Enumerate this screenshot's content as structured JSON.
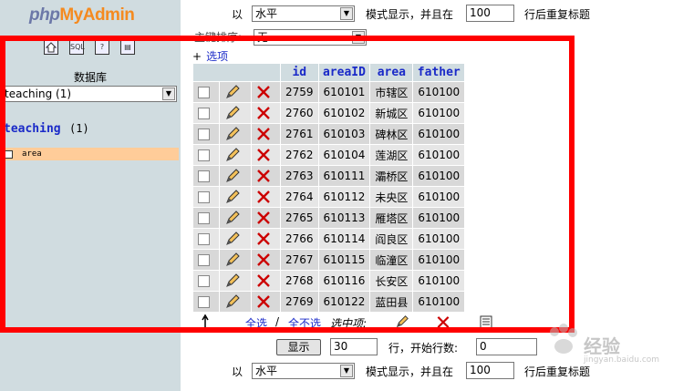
{
  "sidebar": {
    "logo": {
      "php": "php",
      "my": "My",
      "admin": "Admin"
    },
    "toolbar_icons": [
      "home-icon",
      "sql-icon",
      "help-icon",
      "docs-icon"
    ],
    "db_label": "数据库",
    "db_select_value": "teaching (1)",
    "db_link": "teaching",
    "db_count": "(1)",
    "table_item": "area"
  },
  "top_controls": {
    "prefix": "以",
    "mode_value": "水平",
    "mode_suffix": "模式显示，并且在",
    "repeat_value": "100",
    "repeat_suffix": "行后重复标题",
    "sort_label": "主键排序:",
    "sort_value": "无"
  },
  "options_link": "选项",
  "table": {
    "headers": [
      "id",
      "areaID",
      "area",
      "father"
    ],
    "rows": [
      [
        "2759",
        "610101",
        "市辖区",
        "610100"
      ],
      [
        "2760",
        "610102",
        "新城区",
        "610100"
      ],
      [
        "2761",
        "610103",
        "碑林区",
        "610100"
      ],
      [
        "2762",
        "610104",
        "莲湖区",
        "610100"
      ],
      [
        "2763",
        "610111",
        "灞桥区",
        "610100"
      ],
      [
        "2764",
        "610112",
        "未央区",
        "610100"
      ],
      [
        "2765",
        "610113",
        "雁塔区",
        "610100"
      ],
      [
        "2766",
        "610114",
        "阎良区",
        "610100"
      ],
      [
        "2767",
        "610115",
        "临潼区",
        "610100"
      ],
      [
        "2768",
        "610116",
        "长安区",
        "610100"
      ],
      [
        "2769",
        "610122",
        "蓝田县",
        "610100"
      ]
    ]
  },
  "bulk": {
    "check_all": "全选",
    "separator": "/",
    "uncheck_all": "全不选",
    "with_selected": "选中项:"
  },
  "bottom_controls": {
    "show_button": "显示",
    "rows_value": "30",
    "start_label": "行，开始行数:",
    "start_value": "0",
    "prefix": "以",
    "mode_value": "水平",
    "mode_suffix": "模式显示，并且在",
    "repeat_value": "100",
    "repeat_suffix": "行后重复标题"
  },
  "watermark": {
    "cn": "经验",
    "en": "jingyan.baidu.com"
  },
  "colors": {
    "sidebar_bg": "#d0dce0",
    "link": "#1a2ac8",
    "highlight": "#ff0000",
    "selected_table": "#ffcc99"
  }
}
